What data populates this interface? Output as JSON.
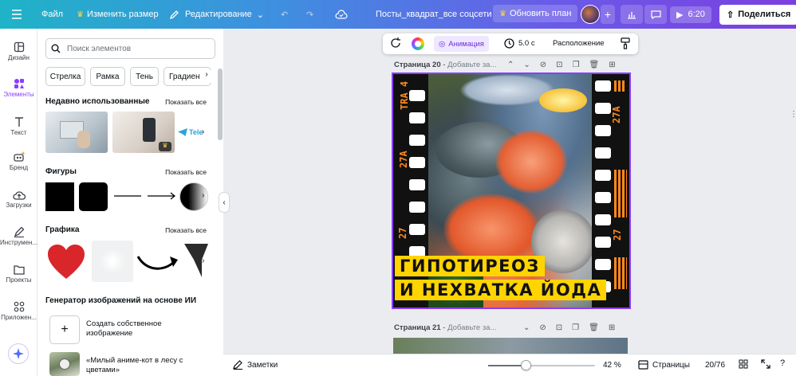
{
  "topbar": {
    "file": "Файл",
    "resize": "Изменить размер",
    "edit_mode": "Редактирование",
    "doc_title": "Посты_квадрат_все соцсети",
    "upgrade": "Обновить план",
    "play_time": "6:20",
    "share": "Поделиться"
  },
  "rail": {
    "design": "Дизайн",
    "elements": "Элементы",
    "text": "Текст",
    "brand": "Бренд",
    "uploads": "Загрузки",
    "tools": "Инструмен...",
    "projects": "Проекты",
    "apps": "Приложен..."
  },
  "panel": {
    "search_placeholder": "Поиск элементов",
    "chips": [
      "Стрелка",
      "Рамка",
      "Тень",
      "Градиент"
    ],
    "recent_title": "Недавно использованные",
    "show_all": "Показать все",
    "recent_third": "Tele",
    "shapes_title": "Фигуры",
    "graphics_title": "Графика",
    "generator_title": "Генератор изображений на основе ИИ",
    "create_own": "Создать собственное изображение",
    "sample_prompt": "«Милый аниме-кот в лесу с цветами»"
  },
  "canvas_toolbar": {
    "animation": "Анимация",
    "duration": "5.0 с",
    "position": "Расположение"
  },
  "pages": [
    {
      "label": "Страница 20",
      "add_title": "Добавьте за..."
    },
    {
      "label": "Страница 21",
      "add_title": "Добавьте за..."
    }
  ],
  "design": {
    "line1": "ГИПОТИРЕОЗ",
    "line2": "И НЕХВАТКА ЙОДА",
    "film_left_top": "TRA 4",
    "film_left_mid": "27A",
    "film_left_bot": "27",
    "film_right_top": "27A",
    "film_right_bot": "27"
  },
  "footer": {
    "notes": "Заметки",
    "zoom": "42 %",
    "pages_label": "Страницы",
    "page_count": "20/76"
  },
  "colors": {
    "accent": "#8b3dff",
    "headline_bg": "#ffd400",
    "film_text": "#ff8a1f"
  }
}
